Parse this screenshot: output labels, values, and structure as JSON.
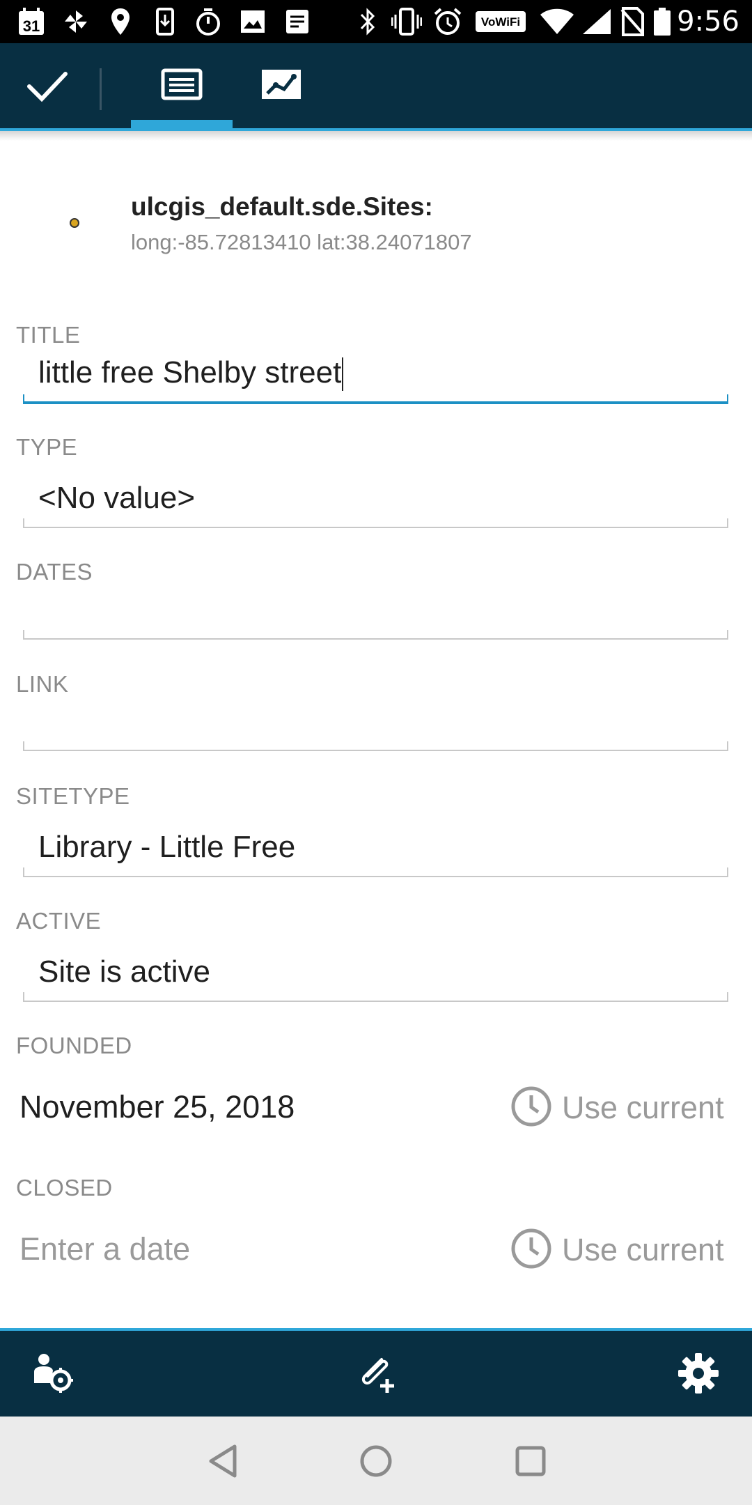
{
  "status_bar": {
    "time": "9:56",
    "icons": [
      "calendar-icon",
      "pinwheel-icon",
      "location-pin-icon",
      "download-icon",
      "stopwatch-icon",
      "image-icon",
      "document-icon",
      "bluetooth-icon",
      "vibrate-icon",
      "alarm-icon",
      "vowifi-icon",
      "wifi-icon",
      "cell-signal-icon",
      "no-sim-icon",
      "battery-icon"
    ],
    "calendar_day": "31",
    "vowifi_label": "VoWiFi"
  },
  "app_bar": {
    "confirm_icon": "checkmark-icon",
    "tabs": [
      {
        "name": "attributes",
        "icon": "list-icon",
        "selected": true
      },
      {
        "name": "geometry",
        "icon": "geometry-icon",
        "selected": false
      }
    ]
  },
  "feature": {
    "title": "ulcgis_default.sde.Sites:",
    "coordinates": "long:-85.72813410 lat:38.24071807"
  },
  "fields": {
    "title": {
      "label": "TITLE",
      "value": "little free Shelby street"
    },
    "type": {
      "label": "TYPE",
      "value": "<No value>"
    },
    "dates": {
      "label": "DATES",
      "value": ""
    },
    "link": {
      "label": "LINK",
      "value": ""
    },
    "sitetype": {
      "label": "SITETYPE",
      "value": "Library - Little Free"
    },
    "active": {
      "label": "ACTIVE",
      "value": "Site is active"
    },
    "founded": {
      "label": "FOUNDED",
      "value": "November 25, 2018",
      "use_current": "Use current"
    },
    "closed": {
      "label": "CLOSED",
      "placeholder": "Enter a date",
      "use_current": "Use current"
    }
  },
  "bottom_bar": {
    "buttons": [
      "user-location-icon",
      "attachment-add-icon",
      "settings-gear-icon"
    ]
  },
  "nav_bar": {
    "buttons": [
      "back-icon",
      "home-icon",
      "recents-icon"
    ]
  },
  "colors": {
    "app_bar": "#082f42",
    "accent": "#2fa7d9",
    "label": "#8a8a8a"
  }
}
